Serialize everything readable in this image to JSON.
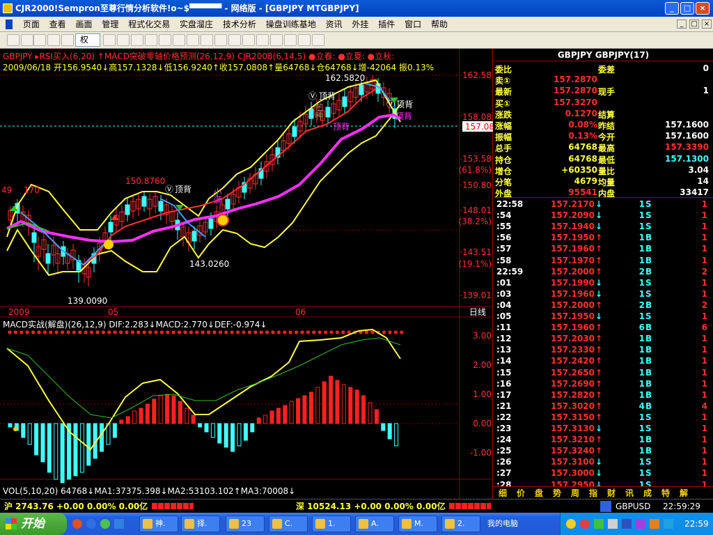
{
  "window": {
    "title": "CJR2000!Sempron至尊行情分析软件!o~$▀▀▀▀▀  - 网络版 - [GBPJPY MTGBPJPY]",
    "min": "_",
    "max": "□",
    "close": "×"
  },
  "menu": [
    "页面",
    "查看",
    "画面",
    "管理",
    "程式化交易",
    "实盘溜庄",
    "技术分析",
    "操盘训练基地",
    "资讯",
    "外挂",
    "插件",
    "窗口",
    "帮助"
  ],
  "toolbar": {
    "period_select": "权"
  },
  "chart": {
    "header1": "GBPJPY ▸RSI买入(6,20) ↑MACD突破零轴价格预测(26,12,9) CJR2008(6,14,5) ●立春: ●立夏: ●立秋:",
    "header2": "2009/06/18 开156.9540↓高157.1328↓低156.9240↑收157.0808↑量64768↓仓64768↓增-42064 振0.13%",
    "price_axis": [
      "162.58",
      "158.08",
      "153.58",
      "(61.8%)",
      "150.80",
      "148.01",
      "(38.2%)",
      "143.51",
      "(19.1%)",
      "139.01"
    ],
    "current_price": "157.08",
    "date_axis": [
      "2009",
      "05",
      "06"
    ],
    "period": "日线",
    "labels": {
      "high": "162.5820",
      "mid_high": "150.8760",
      "low1": "143.0260",
      "low2": "139.0090",
      "left_top": "49",
      "left_top2": "170",
      "top_back1": "顶背",
      "top_back2": "顶背",
      "top_back3": "顶背",
      "small_full": "小满",
      "mountain": "芒种",
      "icon_v": "Ⓥ"
    },
    "macd_header": "MACD实战(解盘)(26,12,9) DIF:2.283↓MACD:2.770↓DEF:-0.974↓",
    "macd_axis": [
      "3.00",
      "2.00",
      "1.00",
      "0.00",
      "-1.00"
    ],
    "vol_header": "VOL(5,10,20) 64768↓MA1:37375.398↓MA2:53103.102↑MA3:70008↓",
    "colors": {
      "up": "#ff3030",
      "down": "#40ffff",
      "ma_pink": "#ff30ff",
      "ma_yellow": "#ffff40",
      "ma_green": "#30c030",
      "grid": "#8a0000"
    }
  },
  "quote": {
    "title": "GBPJPY GBPJPY(17)",
    "rows": [
      {
        "l1": "委比",
        "v1": "",
        "l2": "委差",
        "v2": "0"
      },
      {
        "l1": "卖①",
        "v1": "157.2870",
        "l2": "",
        "v2": ""
      },
      {
        "l1": "最新",
        "v1": "157.2870",
        "l2": "现手",
        "v2": "1"
      },
      {
        "l1": "买①",
        "v1": "157.3270",
        "l2": "",
        "v2": ""
      },
      {
        "l1": "涨跌",
        "v1": "0.1270",
        "l2": "结算",
        "v2": ""
      },
      {
        "l1": "涨幅",
        "v1": "0.08%",
        "l2": "昨结",
        "v2": "157.1600"
      },
      {
        "l1": "振幅",
        "v1": "0.13%",
        "l2": "今开",
        "v2": "157.1600"
      },
      {
        "l1": "总手",
        "v1": "64768",
        "l2": "最高",
        "v2": "157.3390"
      },
      {
        "l1": "持仓",
        "v1": "64768",
        "l2": "最低",
        "v2": "157.1300"
      },
      {
        "l1": "增仓",
        "v1": "+60350",
        "l2": "量比",
        "v2": "3.04"
      },
      {
        "l1": "分笔",
        "v1": "4679",
        "l2": "均量",
        "v2": "14"
      },
      {
        "l1": "外盘",
        "v1": "95541",
        "l2": "内盘",
        "v2": "33417"
      }
    ],
    "ticks": [
      {
        "t": "22:58",
        "p": "157.2170",
        "a": "↓",
        "n": "1",
        "s": "S",
        "c": "1"
      },
      {
        "t": ":54",
        "p": "157.2090",
        "a": "↓",
        "n": "1",
        "s": "S",
        "c": "1"
      },
      {
        "t": ":55",
        "p": "157.1940",
        "a": "↓",
        "n": "1",
        "s": "S",
        "c": "1"
      },
      {
        "t": ":56",
        "p": "157.1950",
        "a": "↑",
        "n": "1",
        "s": "B",
        "c": "1"
      },
      {
        "t": ":57",
        "p": "157.1960",
        "a": "↑",
        "n": "1",
        "s": "B",
        "c": "1"
      },
      {
        "t": ":58",
        "p": "157.1970",
        "a": "↑",
        "n": "1",
        "s": "B",
        "c": "1"
      },
      {
        "t": "22:59",
        "p": "157.2000",
        "a": "↑",
        "n": "2",
        "s": "B",
        "c": "2"
      },
      {
        "t": ":01",
        "p": "157.1990",
        "a": "↓",
        "n": "1",
        "s": "S",
        "c": "1"
      },
      {
        "t": ":03",
        "p": "157.1960",
        "a": "↓",
        "n": "1",
        "s": "S",
        "c": "1"
      },
      {
        "t": ":04",
        "p": "157.2000",
        "a": "↑",
        "n": "2",
        "s": "B",
        "c": "2"
      },
      {
        "t": ":05",
        "p": "157.1950",
        "a": "↓",
        "n": "1",
        "s": "S",
        "c": "1"
      },
      {
        "t": ":11",
        "p": "157.1960",
        "a": "↑",
        "n": "6",
        "s": "B",
        "c": "6"
      },
      {
        "t": ":12",
        "p": "157.2030",
        "a": "↑",
        "n": "1",
        "s": "B",
        "c": "1"
      },
      {
        "t": ":13",
        "p": "157.2330",
        "a": "↑",
        "n": "1",
        "s": "B",
        "c": "1"
      },
      {
        "t": ":14",
        "p": "157.2420",
        "a": "↑",
        "n": "1",
        "s": "B",
        "c": "1"
      },
      {
        "t": ":15",
        "p": "157.2650",
        "a": "↑",
        "n": "1",
        "s": "B",
        "c": "1"
      },
      {
        "t": ":16",
        "p": "157.2690",
        "a": "↑",
        "n": "1",
        "s": "B",
        "c": "1"
      },
      {
        "t": ":17",
        "p": "157.2820",
        "a": "↑",
        "n": "1",
        "s": "B",
        "c": "1"
      },
      {
        "t": ":21",
        "p": "157.3020",
        "a": "↑",
        "n": "4",
        "s": "B",
        "c": "4"
      },
      {
        "t": ":22",
        "p": "157.3150",
        "a": "↑",
        "n": "1",
        "s": "S",
        "c": "1"
      },
      {
        "t": ":23",
        "p": "157.3130",
        "a": "↓",
        "n": "1",
        "s": "S",
        "c": "1"
      },
      {
        "t": ":24",
        "p": "157.3210",
        "a": "↑",
        "n": "1",
        "s": "B",
        "c": "1"
      },
      {
        "t": ":25",
        "p": "157.3240",
        "a": "↑",
        "n": "1",
        "s": "B",
        "c": "1"
      },
      {
        "t": ":26",
        "p": "157.3100",
        "a": "↓",
        "n": "1",
        "s": "S",
        "c": "1"
      },
      {
        "t": ":27",
        "p": "157.3000",
        "a": "↓",
        "n": "1",
        "s": "S",
        "c": "1"
      },
      {
        "t": ":28",
        "p": "157.2950",
        "a": "↓",
        "n": "1",
        "s": "S",
        "c": "1"
      }
    ],
    "tabs": [
      "细",
      "价",
      "盘",
      "势",
      "周",
      "指",
      "财",
      "讯",
      "成",
      "特",
      "解"
    ]
  },
  "status": {
    "sh": "沪 2743.76 +0.00 0.00% 0.00亿",
    "sz": "深 10524.13 +0.00 0.00% 0.00亿",
    "symbol": "GBPUSD",
    "time": "22:59:29"
  },
  "taskbar": {
    "start": "开始",
    "tasks": [
      "神.",
      "择.",
      "23",
      "C.",
      "1.",
      "A.",
      "M.",
      "2."
    ],
    "tray_text": "我的电脑",
    "clock": "22:59"
  }
}
